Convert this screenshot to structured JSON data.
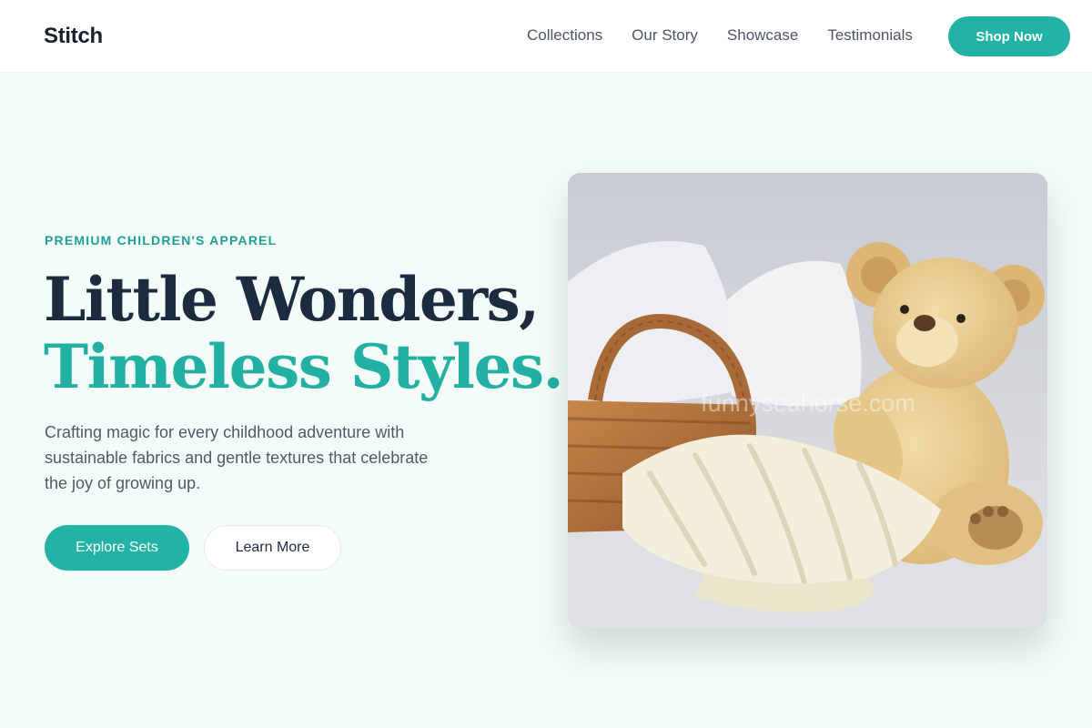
{
  "brand": {
    "name": "Stitch"
  },
  "nav": {
    "items": [
      {
        "label": "Collections"
      },
      {
        "label": "Our Story"
      },
      {
        "label": "Showcase"
      },
      {
        "label": "Testimonials"
      }
    ],
    "cta_label": "Shop Now"
  },
  "hero": {
    "eyebrow": "PREMIUM CHILDREN'S APPAREL",
    "headline_line1": "Little Wonders,",
    "headline_line2": "Timeless Styles.",
    "subtext": "Crafting magic for every childhood adventure with sustainable fabrics and gentle textures that celebrate the joy of growing up.",
    "primary_button": "Explore Sets",
    "secondary_button": "Learn More",
    "image_watermark": "funnyseahorse.com"
  },
  "colors": {
    "accent": "#23b3a6",
    "heading": "#1c2b3e",
    "background": "#f4fcf9"
  }
}
